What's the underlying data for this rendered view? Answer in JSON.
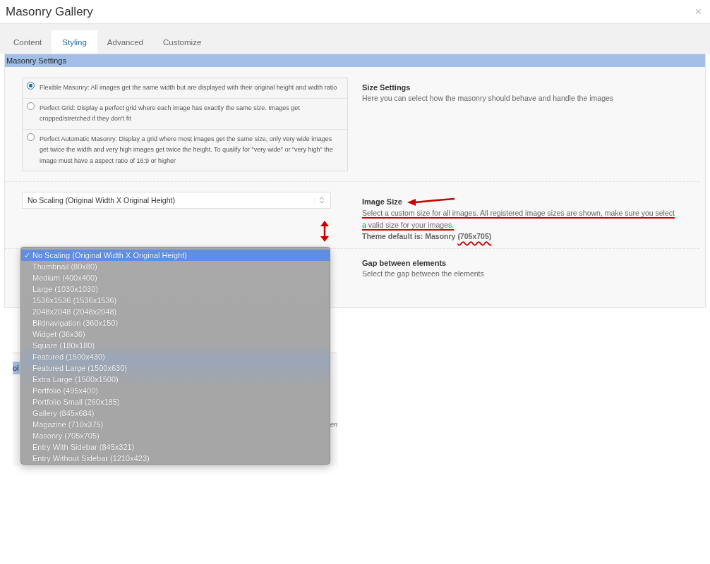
{
  "window": {
    "title": "Masonry Gallery",
    "close": "×"
  },
  "tabs": [
    {
      "label": "Content",
      "selected": false
    },
    {
      "label": "Styling",
      "selected": true
    },
    {
      "label": "Advanced",
      "selected": false
    },
    {
      "label": "Customize",
      "selected": false
    }
  ],
  "panel": {
    "title": "Masonry Settings"
  },
  "size_settings": {
    "title": "Size Settings",
    "description": "Here you can select how the masonry should behave and handle the images",
    "options": [
      {
        "label": "Flexible Masonry: All images get the same width but are displayed with their original height and width ratio",
        "selected": true
      },
      {
        "label": "Perfect Grid: Display a perfect grid where each image has exactly the same size. Images get cropped/stretched if they don't fit",
        "selected": false
      },
      {
        "label": "Perfect Automatic Masonry: Display a grid where most images get the same size, only very wide images get twice the width and very high images get twice the height. To qualify for \"very wide\" or \"very high\" the image must have a aspect ratio of 16:9 or higher",
        "selected": false
      }
    ]
  },
  "image_size": {
    "title": "Image Size",
    "description": "Select a custom size for all images. All registered image sizes are shown, make sure you select a valid size for your images.",
    "theme_default": "Theme default is: Masonry (705x705)",
    "value": "No Scaling (Original Width X Original Height)",
    "options": [
      {
        "label": "No Scaling (Original Width X Original Height)",
        "selected": true,
        "check": "✓"
      },
      {
        "label": "Thumbnail (80x80)",
        "selected": false
      },
      {
        "label": "Medium (400x400)",
        "selected": false
      },
      {
        "label": "Large (1030x1030)",
        "selected": false
      },
      {
        "label": "1536x1536 (1536x1536)",
        "selected": false
      },
      {
        "label": "2048x2048 (2048x2048)",
        "selected": false
      },
      {
        "label": "Bildnavigation (360x150)",
        "selected": false
      },
      {
        "label": "Widget (36x36)",
        "selected": false
      },
      {
        "label": "Square (180x180)",
        "selected": false
      },
      {
        "label": "Featured (1500x430)",
        "selected": false
      },
      {
        "label": "Featured Large (1500x630)",
        "selected": false
      },
      {
        "label": "Extra Large (1500x1500)",
        "selected": false
      },
      {
        "label": "Portfolio (495x400)",
        "selected": false
      },
      {
        "label": "Portfolio Small (260x185)",
        "selected": false
      },
      {
        "label": "Gallery (845x684)",
        "selected": false
      },
      {
        "label": "Magazine (710x375)",
        "selected": false
      },
      {
        "label": "Masonry (705x705)",
        "selected": false
      },
      {
        "label": "Entry With Sidebar (845x321)",
        "selected": false
      },
      {
        "label": "Entry Without Sidebar (1210x423)",
        "selected": false
      }
    ]
  },
  "gap": {
    "title": "Gap between elements",
    "description": "Select the gap between the elements"
  },
  "background_panel": {
    "header_fragment": "ol",
    "text_fragment": "en"
  }
}
